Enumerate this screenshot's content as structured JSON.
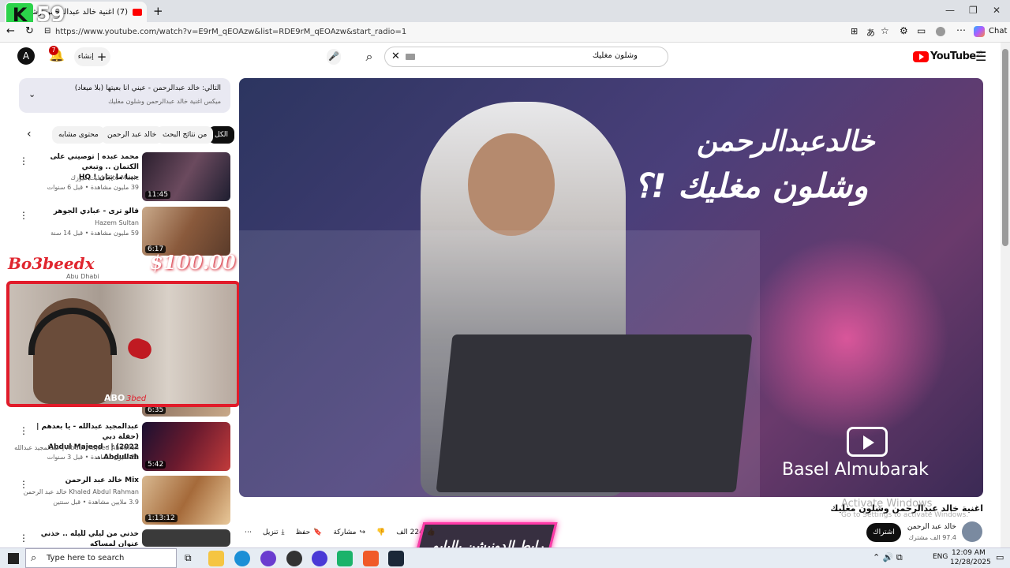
{
  "browser": {
    "tab_title": "(7) اغنية خالد عبدالرحمن وشلون مغليك",
    "url": "https://www.youtube.com/watch?v=E9rM_qEOAzw&list=RDE9rM_qEOAzw&start_radio=1",
    "chat_label": "Chat",
    "overlay_number": "59"
  },
  "header": {
    "logo_text": "YouTube",
    "logo_sup": "JO",
    "search_value": "وشلون مغليك",
    "create_label": "إنشاء",
    "notif_count": "7",
    "avatar_letter": "A"
  },
  "next_card": {
    "title": "التالي: خالد عبدالرحمن - عيني انا بعيتها (بلا ميعاد)",
    "sub": "ميكس اغنية خالد عبدالرحمن وشلون مغليك"
  },
  "chips": [
    "الكل",
    "من نتائج البحث",
    "خالد عبد الرحمن",
    "محتوى مشابه"
  ],
  "videos": [
    {
      "title": "محمد عبده | توصيني على الكتمان .. وتبغي\nحبنا ما يبان ! HQ",
      "channel": "Elite Music ايليت ميوزك",
      "meta": "39 مليون مشاهدة • قبل 6 سنوات",
      "duration": "11:45"
    },
    {
      "title": "قالو ترى - عبادي الجوهر",
      "channel": "Hazem Sultan",
      "meta": "59 مليون مشاهدة • قبل 14 سنة",
      "duration": "6:17"
    },
    {
      "title": "عبدالمجيد عبدالله - يا بعدهم | (حفلة دبي\n2022) | - Abdul Majeed Abdullah...",
      "channel": "Abdul Majeed Abdullah | عبدالمجيد عبدالله",
      "meta": "21 مليون مشاهدة • قبل 3 سنوات",
      "duration": "5:42"
    },
    {
      "title": "Mix خالد عبد الرحمن",
      "channel": "Khaled Abdul Rahman خالد عبد الرحمن",
      "meta": "3.9 ملايين مشاهدة • قبل سنتين",
      "duration": "1:13:12"
    },
    {
      "title": "خذني من ليلي للّيله .. خذني عنوان لمساكه",
      "channel": "",
      "meta": "",
      "duration": ""
    }
  ],
  "hidden_item_duration": "6:35",
  "hidden_channel": "Abu Dhabi",
  "video": {
    "artist_title": "خالدعبدالرحمن",
    "song_title": "وشلون مغليك !؟",
    "watermark": "Basel Almubarak",
    "title": "اغنية خالد عبدالرحمن وشلون مغليك",
    "channel": "خالد عبد الرحمن",
    "subs": "97.4 الف مشترك",
    "subscribe": "اشتراك",
    "likes": "224 الف",
    "share": "مشاركة",
    "save": "حفظ",
    "download": "تنزيل"
  },
  "stream_overlay": {
    "name": "Bo3beedx",
    "amount": "$100.00",
    "cam_label": "ABO",
    "cam_label2": "3bed",
    "banner": "رابط الدونيشن بالبايو"
  },
  "activate": {
    "line1": "Activate Windows",
    "line2": "Go to Settings to activate Windows."
  },
  "taskbar": {
    "search_placeholder": "Type here to search",
    "lang": "ENG",
    "time": "12:09 AM",
    "date": "12/28/2025"
  },
  "colors": {
    "yt_red": "#ff0000",
    "cam_frame": "#e11b2a",
    "banner_pink": "#ff3aa8"
  }
}
